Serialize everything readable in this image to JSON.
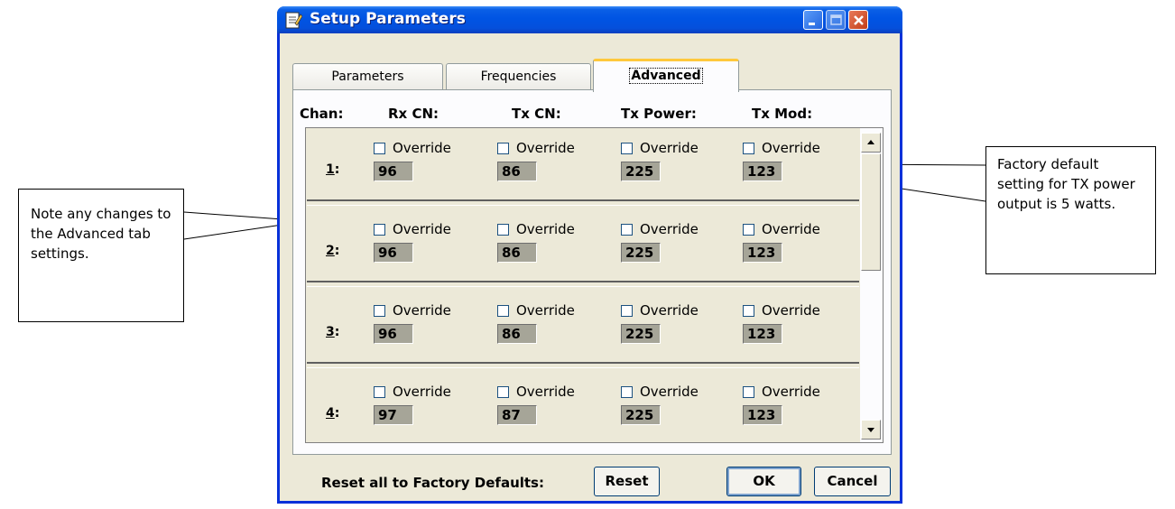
{
  "window": {
    "title": "Setup Parameters",
    "minimize_icon": "minimize-icon",
    "maximize_icon": "maximize-icon",
    "close_icon": "close-icon"
  },
  "tabs": [
    {
      "label": "Parameters",
      "selected": false
    },
    {
      "label": "Frequencies",
      "selected": false
    },
    {
      "label": "Advanced",
      "selected": true
    }
  ],
  "columns": {
    "chan": "Chan:",
    "rx_cn": "Rx CN:",
    "tx_cn": "Tx CN:",
    "tx_power": "Tx Power:",
    "tx_mod": "Tx Mod:"
  },
  "override_label": "Override",
  "channels": [
    {
      "num": "1",
      "rx_cn": "96",
      "tx_cn": "86",
      "tx_power": "225",
      "tx_mod": "123"
    },
    {
      "num": "2",
      "rx_cn": "96",
      "tx_cn": "86",
      "tx_power": "225",
      "tx_mod": "123"
    },
    {
      "num": "3",
      "rx_cn": "96",
      "tx_cn": "86",
      "tx_power": "225",
      "tx_mod": "123"
    },
    {
      "num": "4",
      "rx_cn": "97",
      "tx_cn": "87",
      "tx_power": "225",
      "tx_mod": "123"
    }
  ],
  "footer": {
    "reset_label": "Reset all to Factory Defaults:",
    "reset_button": "Reset",
    "ok_button": "OK",
    "cancel_button": "Cancel"
  },
  "callouts": {
    "left": "Note any changes to the Advanced tab settings.",
    "right": "Factory default setting for TX power output is 5 watts."
  },
  "colors": {
    "title_bar": "#0054e3",
    "dialog_face": "#ece9d8",
    "tab_highlight": "#ffc83c",
    "value_box": "#a6a598"
  }
}
